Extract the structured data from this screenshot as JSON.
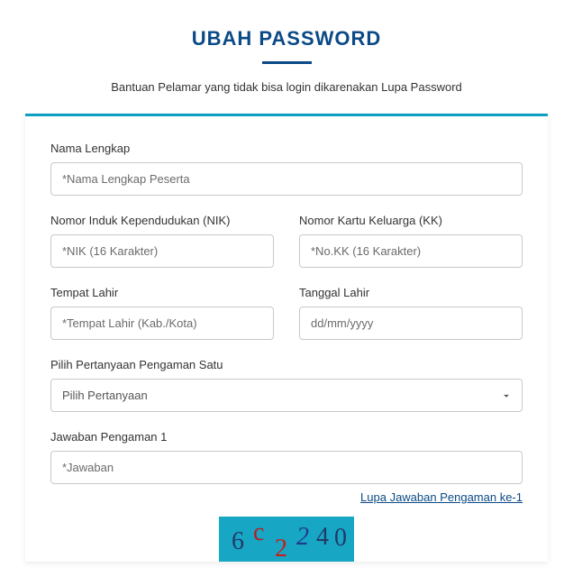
{
  "title": "UBAH PASSWORD",
  "subtitle": "Bantuan Pelamar yang tidak bisa login dikarenakan Lupa Password",
  "fields": {
    "nama": {
      "label": "Nama Lengkap",
      "placeholder": "*Nama Lengkap Peserta"
    },
    "nik": {
      "label": "Nomor Induk Kependudukan (NIK)",
      "placeholder": "*NIK (16 Karakter)"
    },
    "kk": {
      "label": "Nomor Kartu Keluarga (KK)",
      "placeholder": "*No.KK (16 Karakter)"
    },
    "tempat": {
      "label": "Tempat Lahir",
      "placeholder": "*Tempat Lahir (Kab./Kota)"
    },
    "tanggal": {
      "label": "Tanggal Lahir",
      "placeholder": "dd/mm/yyyy"
    },
    "pertanyaan": {
      "label": "Pilih Pertanyaan Pengaman Satu",
      "option": "Pilih Pertanyaan"
    },
    "jawaban": {
      "label": "Jawaban Pengaman 1",
      "placeholder": "*Jawaban"
    }
  },
  "link": {
    "forgot": "Lupa Jawaban Pengaman ke-1"
  },
  "captcha": [
    "6",
    "c",
    "2",
    "2",
    "4",
    "0"
  ]
}
